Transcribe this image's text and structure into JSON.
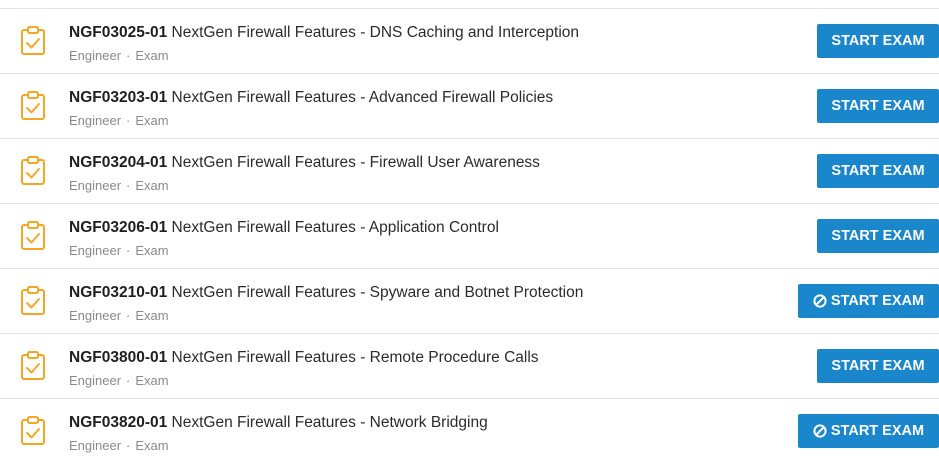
{
  "colors": {
    "accent_button": "#1a86cc",
    "clipboard_icon": "#f5a623",
    "meta_text": "#8a8a8a",
    "divider": "#e3e3e3"
  },
  "exams": [
    {
      "code": "NGF03025-01",
      "name": "NextGen Firewall Features - DNS Caching and Interception",
      "role": "Engineer",
      "type": "Exam",
      "button_label": "START EXAM",
      "button_icon": null
    },
    {
      "code": "NGF03203-01",
      "name": "NextGen Firewall Features - Advanced Firewall Policies",
      "role": "Engineer",
      "type": "Exam",
      "button_label": "START EXAM",
      "button_icon": null
    },
    {
      "code": "NGF03204-01",
      "name": "NextGen Firewall Features - Firewall User Awareness",
      "role": "Engineer",
      "type": "Exam",
      "button_label": "START EXAM",
      "button_icon": null
    },
    {
      "code": "NGF03206-01",
      "name": "NextGen Firewall Features - Application Control",
      "role": "Engineer",
      "type": "Exam",
      "button_label": "START EXAM",
      "button_icon": null
    },
    {
      "code": "NGF03210-01",
      "name": "NextGen Firewall Features - Spyware and Botnet Protection",
      "role": "Engineer",
      "type": "Exam",
      "button_label": "START EXAM",
      "button_icon": "ban-icon"
    },
    {
      "code": "NGF03800-01",
      "name": "NextGen Firewall Features - Remote Procedure Calls",
      "role": "Engineer",
      "type": "Exam",
      "button_label": "START EXAM",
      "button_icon": null
    },
    {
      "code": "NGF03820-01",
      "name": "NextGen Firewall Features - Network Bridging",
      "role": "Engineer",
      "type": "Exam",
      "button_label": "START EXAM",
      "button_icon": "ban-icon"
    }
  ]
}
